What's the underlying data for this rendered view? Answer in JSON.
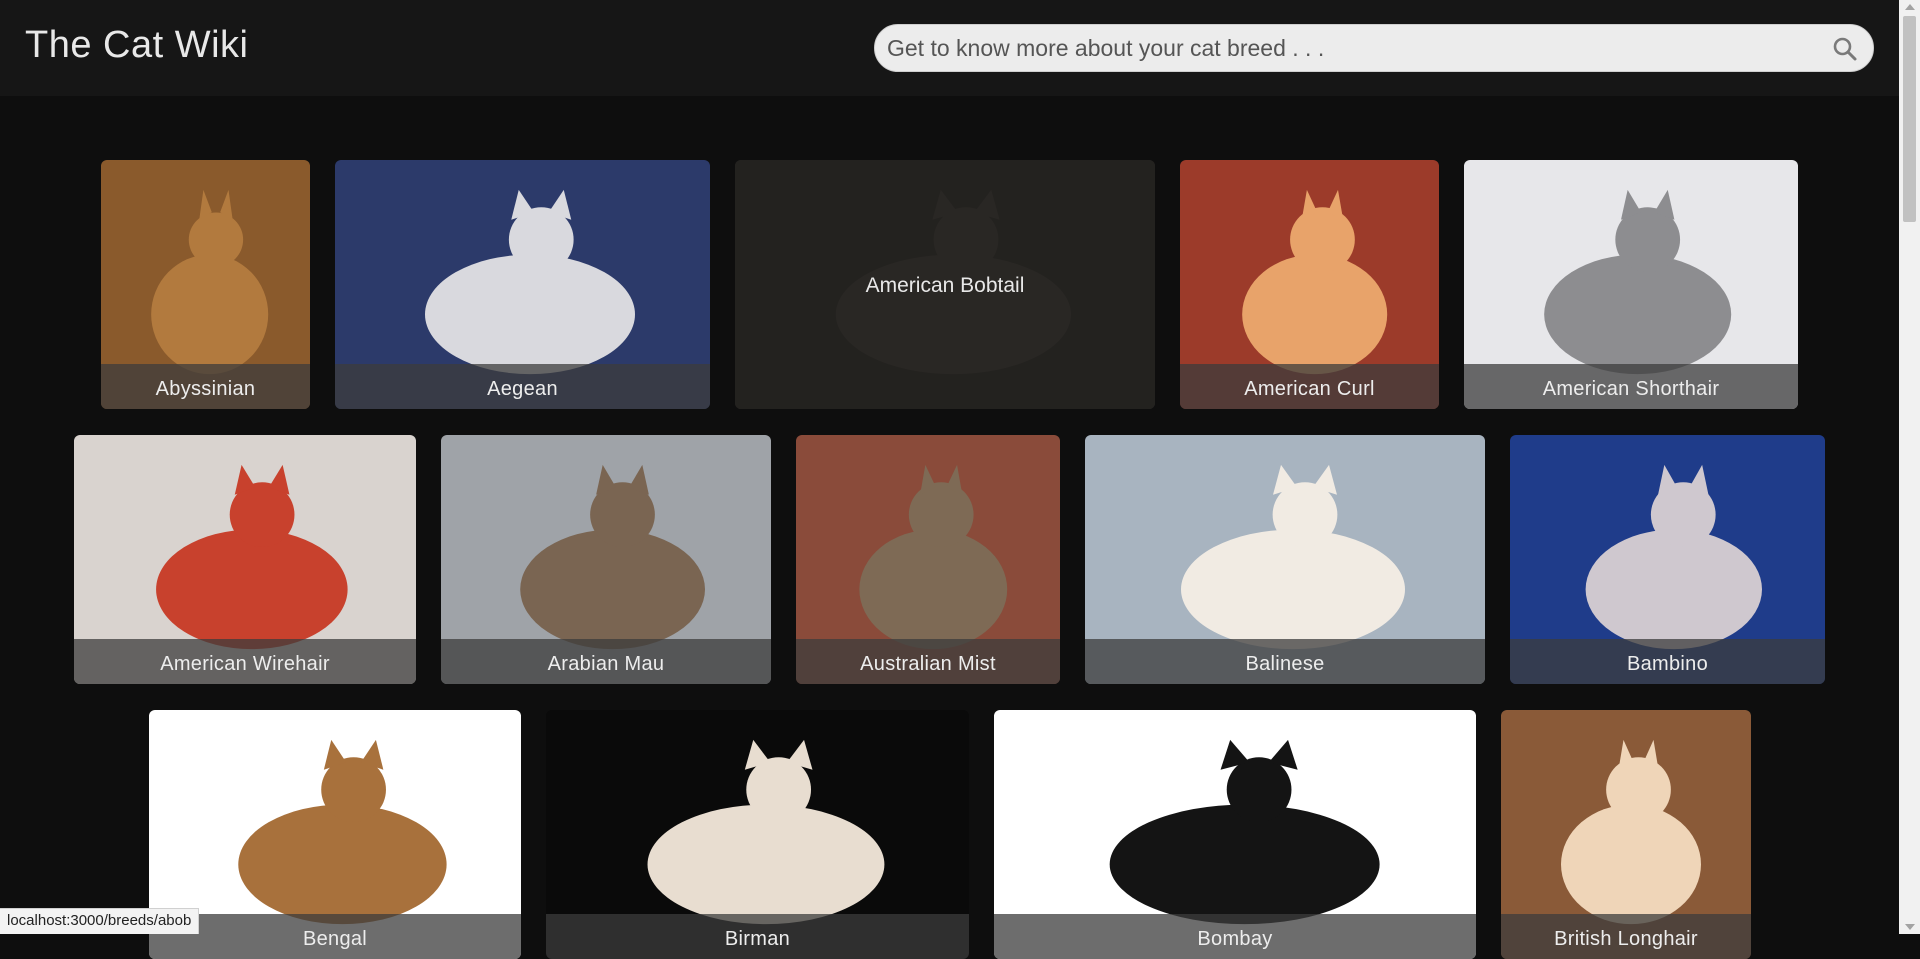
{
  "header": {
    "title": "The Cat Wiki",
    "search_placeholder": "Get to know more about your cat breed . . ."
  },
  "breeds": [
    {
      "name": "Abyssinian",
      "bg": "#8a5a2c",
      "accent": "#b27a3e"
    },
    {
      "name": "Aegean",
      "bg": "#2c3a6a",
      "accent": "#d9d9de"
    },
    {
      "name": "American Bobtail",
      "bg": "#3a3634",
      "accent": "#55504a",
      "hover": true
    },
    {
      "name": "American Curl",
      "bg": "#9c3b2a",
      "accent": "#e8a36a"
    },
    {
      "name": "American Shorthair",
      "bg": "#e7e7ea",
      "accent": "#8d8d90"
    },
    {
      "name": "American Wirehair",
      "bg": "#d9d3cf",
      "accent": "#c8412d"
    },
    {
      "name": "Arabian Mau",
      "bg": "#9fa3a8",
      "accent": "#7a6552"
    },
    {
      "name": "Australian Mist",
      "bg": "#8a4b3a",
      "accent": "#7e6a55"
    },
    {
      "name": "Balinese",
      "bg": "#a8b4c0",
      "accent": "#f1ebe3"
    },
    {
      "name": "Bambino",
      "bg": "#1f3c8a",
      "accent": "#cfc8cf"
    },
    {
      "name": "Bengal",
      "bg": "#ffffff",
      "accent": "#a8713c"
    },
    {
      "name": "Birman",
      "bg": "#0a0a0a",
      "accent": "#e8ddd0"
    },
    {
      "name": "Bombay",
      "bg": "#ffffff",
      "accent": "#141414"
    },
    {
      "name": "British Longhair",
      "bg": "#8a5a38",
      "accent": "#efd5b8"
    }
  ],
  "status_url": "localhost:3000/breeds/abob"
}
